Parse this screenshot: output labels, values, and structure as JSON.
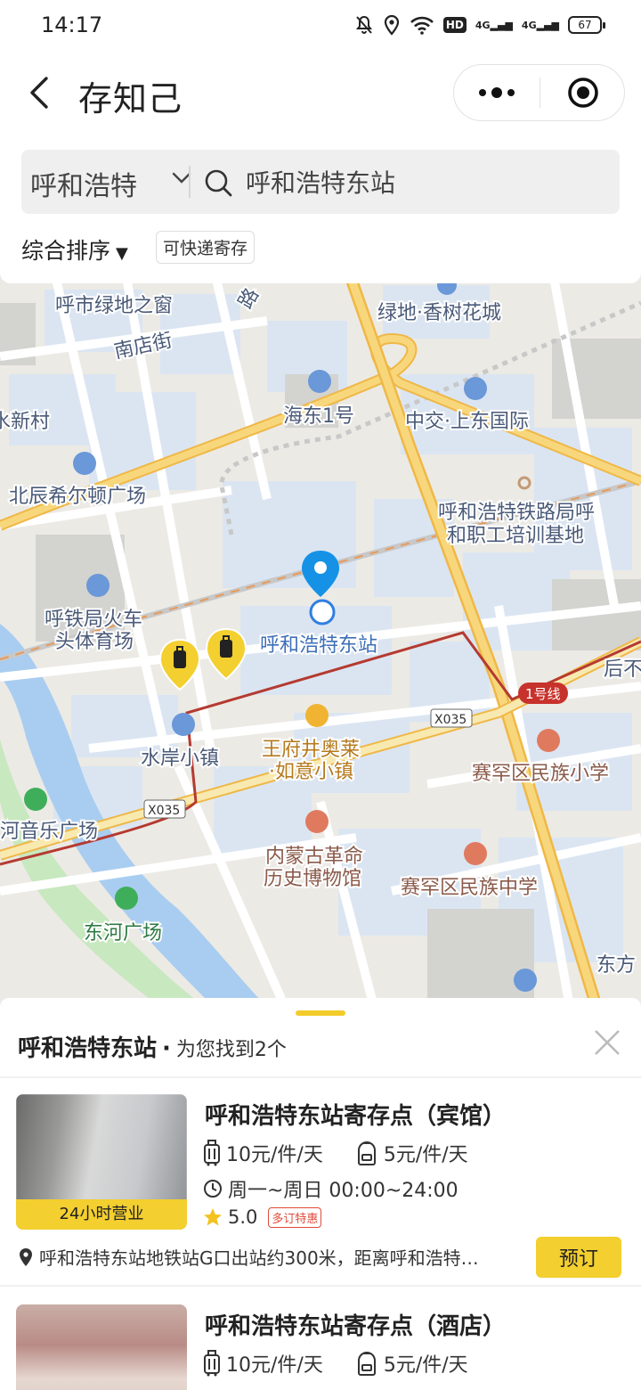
{
  "status": {
    "time": "14:17",
    "battery": "67",
    "hd": "HD",
    "net1": "4G",
    "net2": "4G"
  },
  "header": {
    "title": "存知己"
  },
  "search": {
    "city": "呼和浩特",
    "query": "呼和浩特东站"
  },
  "filters": {
    "sort_label": "综合排序",
    "sort_caret": "▼",
    "express_tag": "可快递寄存"
  },
  "map": {
    "labels": {
      "green_window": "呼市绿地之窗",
      "nandian": "南店街",
      "road_top": "路",
      "xiangshu": "绿地·香树花城",
      "haidong": "海东1号",
      "zhongjiao": "中交·上东国际",
      "xincun": "水新村",
      "beichen": "北辰希尔顿广场",
      "railway_line1": "呼和浩特铁路局呼",
      "railway_line2": "和职工培训基地",
      "sports_line1": "呼铁局火车",
      "sports_line2": "头体育场",
      "station": "呼和浩特东站",
      "later": "后不",
      "line1": "1号线",
      "x035_a": "X035",
      "x035_b": "X035",
      "shuian": "水岸小镇",
      "wangfujing_line1": "王府井奥莱",
      "wangfujing_line2": "·如意小镇",
      "saihan_primary": "赛罕区民族小学",
      "music": "河音乐广场",
      "museum_line1": "内蒙古革命",
      "museum_line2": "历史博物馆",
      "saihan_middle": "赛罕区民族中学",
      "donghe": "东河广场",
      "dongfang": "东方"
    }
  },
  "results": {
    "station": "呼和浩特东站",
    "sep": "·",
    "count_text": "为您找到2个",
    "items": [
      {
        "title": "呼和浩特东站寄存点（宾馆）",
        "badge": "24小时营业",
        "price_luggage": "10元/件/天",
        "price_bag": "5元/件/天",
        "hours": "周一~周日 00:00~24:00",
        "rating": "5.0",
        "promo": "多订特惠",
        "address": "呼和浩特东站地铁站G口出站约300米，距离呼和浩特…",
        "book": "预订"
      },
      {
        "title": "呼和浩特东站寄存点（酒店）",
        "price_luggage": "10元/件/天",
        "price_bag": "5元/件/天"
      }
    ]
  },
  "colors": {
    "accent": "#f3cf2f",
    "pin_blue": "#1592e6",
    "metro_red": "#c0302a",
    "road_yellow": "#f5c65a"
  }
}
